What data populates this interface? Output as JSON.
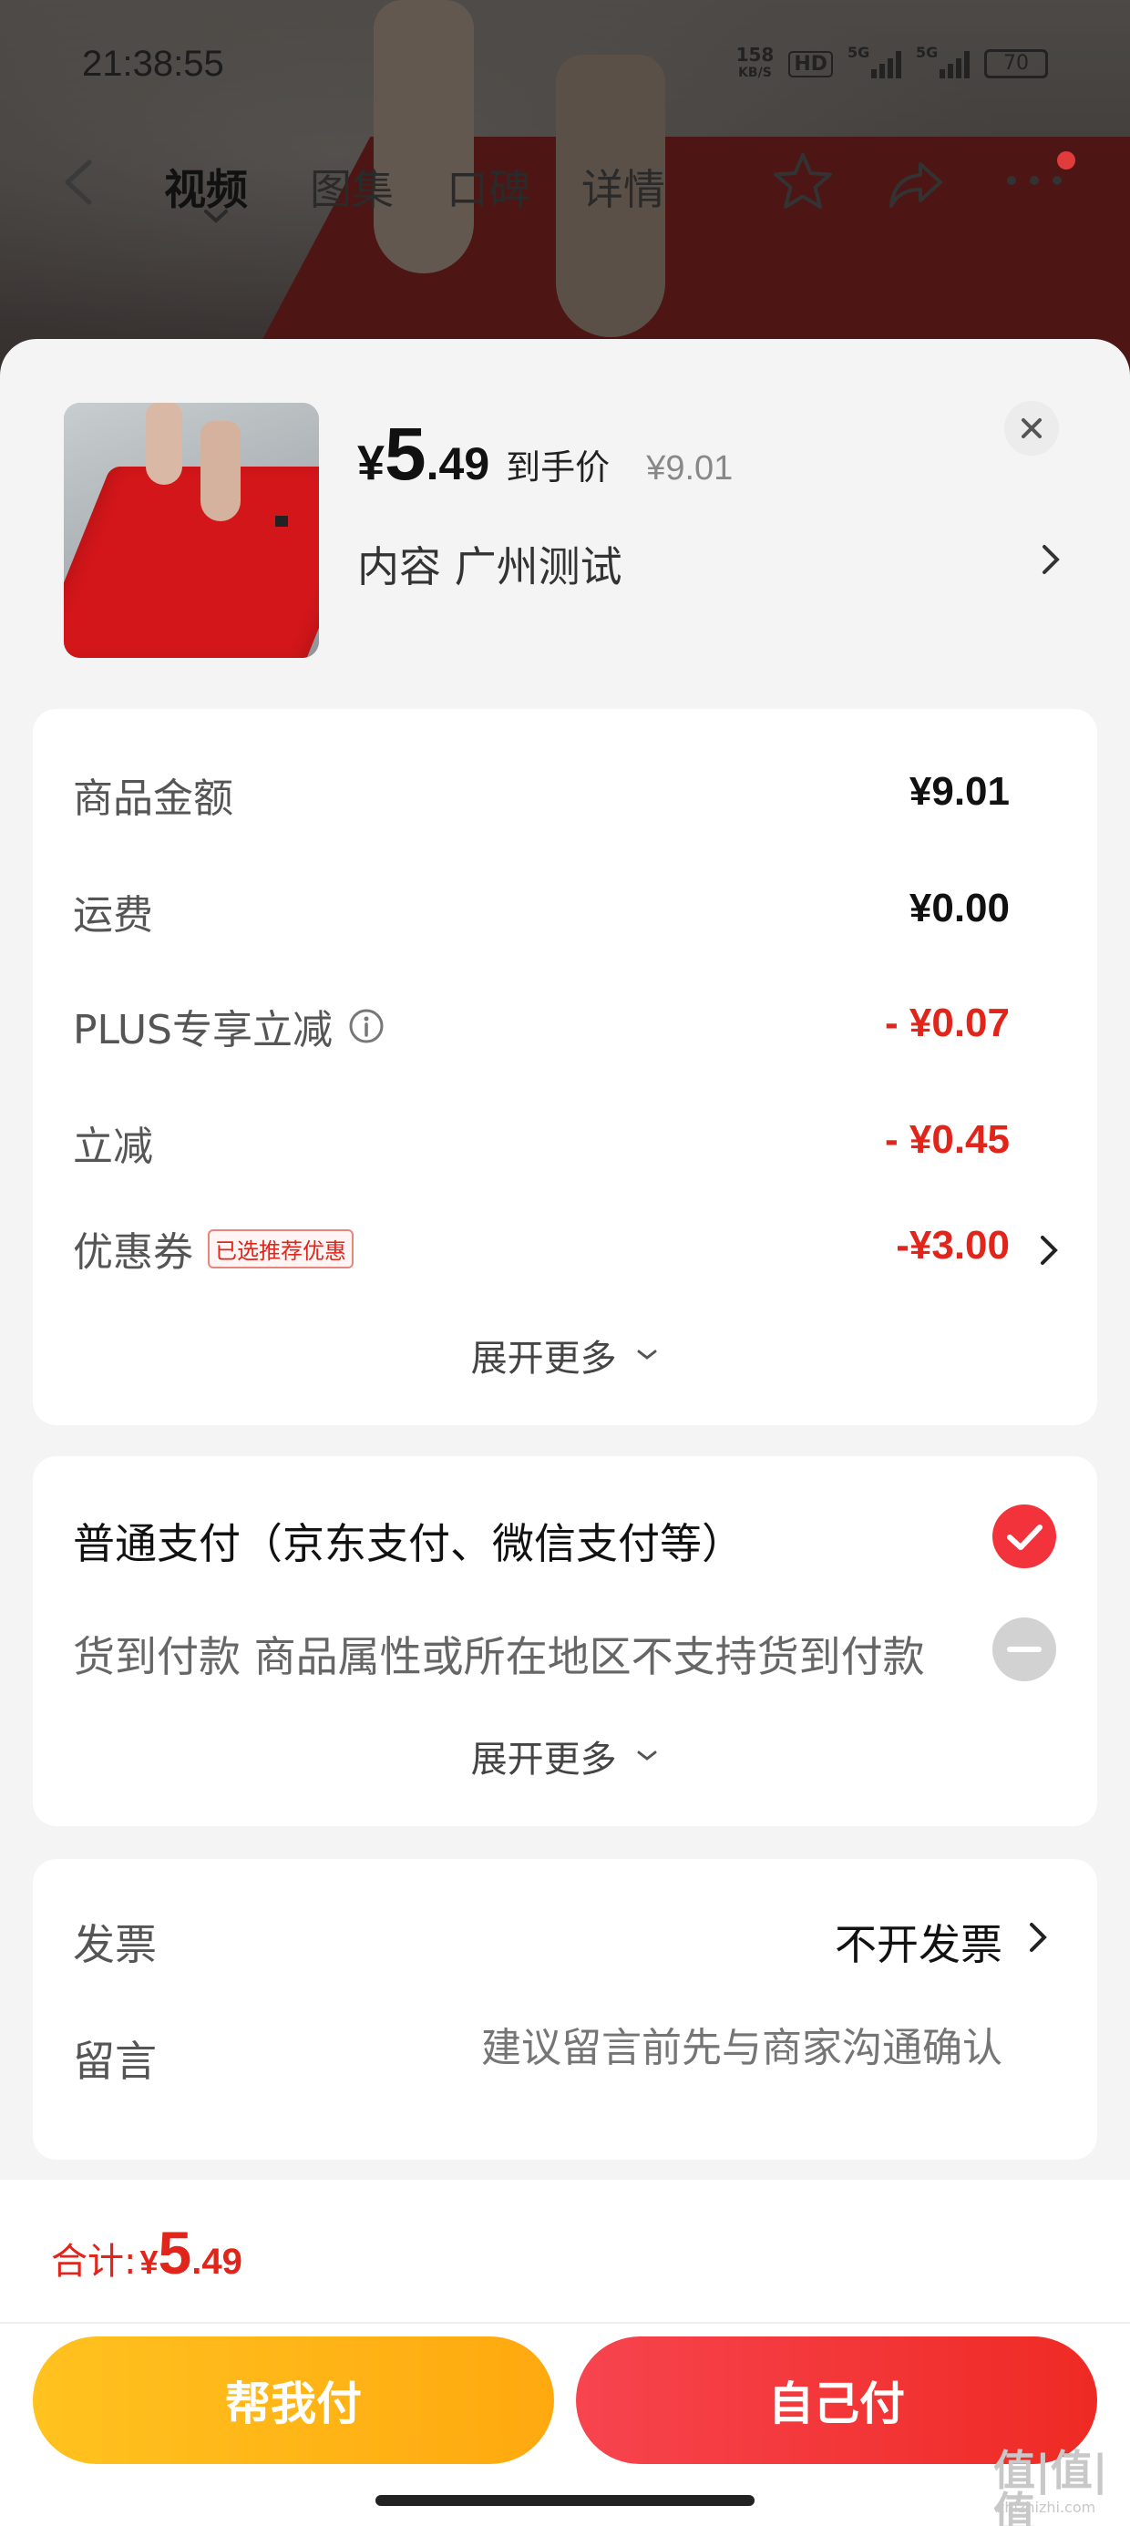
{
  "status_bar": {
    "time": "21:38:55",
    "net_speed": "158",
    "net_unit": "KB/S",
    "hd_badge": "HD",
    "signal1": "5G",
    "signal2": "5G",
    "battery": "70"
  },
  "nav": {
    "tabs": [
      {
        "label": "视频",
        "active": true
      },
      {
        "label": "图集",
        "active": false
      },
      {
        "label": "口碑",
        "active": false
      },
      {
        "label": "详情",
        "active": false
      }
    ]
  },
  "product": {
    "price_yen": "¥",
    "price_int": "5",
    "price_dec": ".49",
    "price_tag": "到手价",
    "original_price": "¥9.01",
    "spec": "内容  广州测试"
  },
  "fees": {
    "rows": [
      {
        "label": "商品金额",
        "value": "¥9.01"
      },
      {
        "label": "运费",
        "value": "¥0.00"
      },
      {
        "label": "PLUS专享立减",
        "value": "- ¥0.07"
      },
      {
        "label": "立减",
        "value": "- ¥0.45"
      },
      {
        "label": "优惠券",
        "value": "-¥3.00",
        "badge": "已选推荐优惠"
      }
    ],
    "expand_label": "展开更多"
  },
  "payment": {
    "options": [
      {
        "label": "普通支付（京东支付、微信支付等）",
        "selected": true
      },
      {
        "label": "货到付款 商品属性或所在地区不支持货到付款",
        "disabled": true
      }
    ],
    "expand_label": "展开更多"
  },
  "extra": {
    "invoice_label": "发票",
    "invoice_value": "不开发票",
    "message_label": "留言",
    "message_placeholder": "建议留言前先与商家沟通确认"
  },
  "bottom": {
    "total_label": "合计:",
    "total_yen": "¥",
    "total_int": "5",
    "total_dec": ".49",
    "help_pay": "帮我付",
    "self_pay": "自己付",
    "watermark": "值|值|值",
    "watermark_sub": "zhizhizhi.com"
  },
  "colors": {
    "accent_red": "#e1251b",
    "help_pay_yellow": "#ffb31a",
    "self_pay_red": "#f03a36"
  }
}
